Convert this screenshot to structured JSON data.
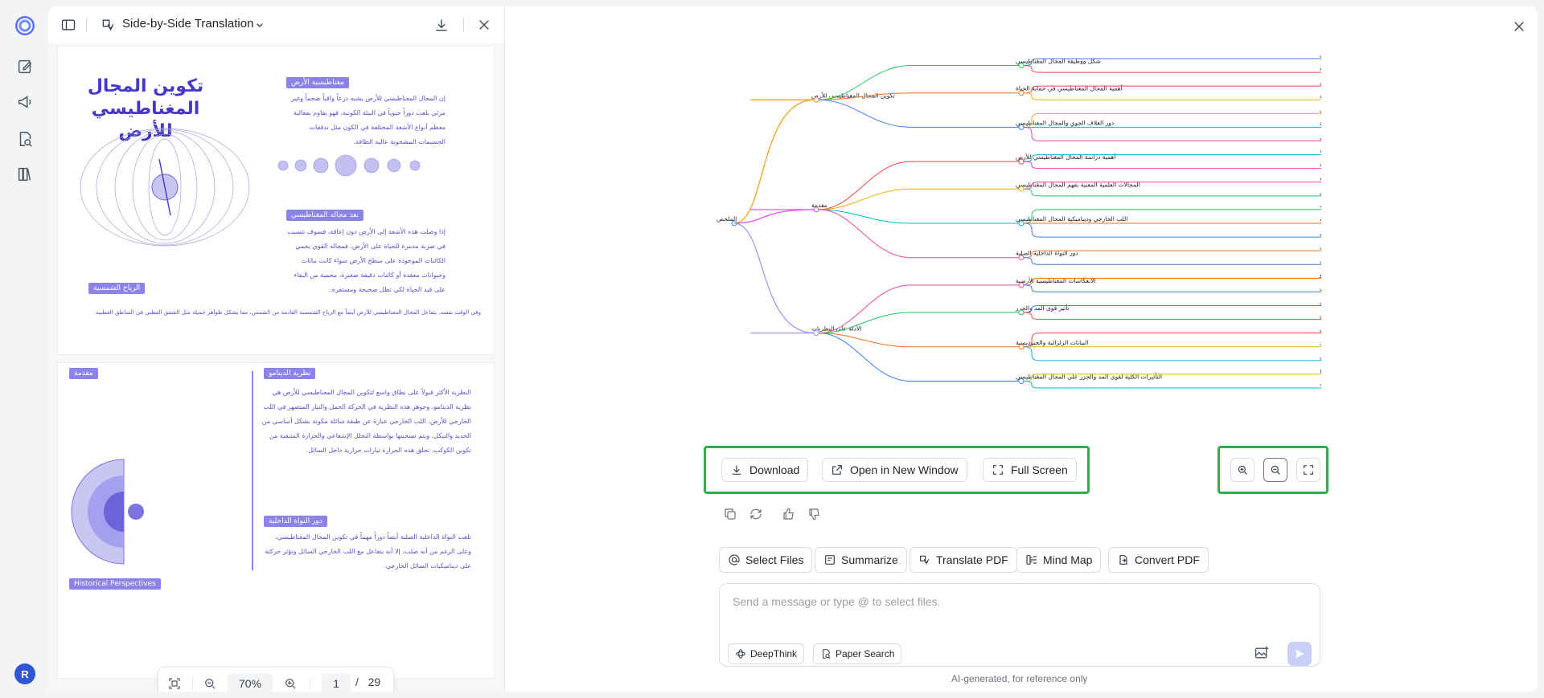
{
  "sidebar": {
    "icons": [
      "app-logo-icon",
      "edit-icon",
      "megaphone-icon",
      "doc-search-icon",
      "library-icon"
    ],
    "avatar_letter": "R"
  },
  "pdf_panel": {
    "title": "Side-by-Side Translation",
    "page1": {
      "title_line1": "تكوين المجال",
      "title_line2": "المغناطيسي للأرض",
      "label_1": "مغناطيسية الأرض",
      "label_2": "بعد مجاله المغناطيسي",
      "label_3": "الرياح الشمسية",
      "para_1": "إن المجال المغناطيسي للأرض يشبه درعاً واقياً ضخماً وغير مرئي يلعب دوراً حيوياً في البيئة الكونية، فهو يقاوم بفعالية معظم أنواع الأشعة المختلفة في الكون مثل تدفقات الجسيمات المشحونة عالية الطاقة.",
      "para_2": "إذا وصلت هذه الأشعة إلى الأرض دون إعاقة، فسوف تتسبب في ضربة مدمرة للحياة على الأرض، فمجاله القوي يحمي الكائنات الموجودة على سطح الأرض سواء كانت نباتات وحيوانات معقدة أو كائنات دقيقة صغيرة، محمية من البقاء على قيد الحياة لكي تظل صحيحة ومستقرة.",
      "para_3": "وفي الوقت نفسه، يتفاعل المجال المغناطيسي للأرض أيضاً مع الرياح الشمسية القادمة من الشمس، مما يشكل ظواهر جميلة مثل الشفق القطبي في المناطق القطبية."
    },
    "page2": {
      "label_intro": "مقدمة",
      "label_dynamo": "نظرية الدينامو",
      "label_core": "دور النواة الداخلية",
      "label_hist": "Historical Perspectives",
      "para_dynamo": "النظرية الأكثر قبولاً على نطاق واسع لتكوين المجال المغناطيسي للأرض هي نظرية الدينامو، وجوهر هذه النظرية في الحركة الحمل والتيار المتصهر في اللب الخارجي للأرض، اللب الخارجي عبارة عن طبقة سائلة مكونة بشكل أساسي من الحديد والنيكل، ويتم تسخينها بواسطة التحلل الإشعاعي والحرارة المتبقية من تكوين الكوكب، تخلق هذه الحرارة تيارات حرارية داخل السائل.",
      "para_core": "تلعب النواة الداخلية الصلبة أيضاً دوراً مهماً في تكوين المجال المغناطيسي، وعلى الرغم من أنه صلب، إلا أنه يتفاعل مع اللب الخارجي السائل وتؤثر حركته على ديناميكيات السائل الخارجي."
    },
    "zoom": {
      "value": "70%",
      "page": "1",
      "separator": "/",
      "total": "29"
    }
  },
  "mindmap": {
    "root": "الملخص",
    "branches": [
      {
        "label": "تكوين المجال المغناطيسي للأرض",
        "children": [
          {
            "label": "شكل ووظيفة المجال المغناطيسي",
            "leaves": [
              "يحمي المجال المغناطيسي الأرض من الإشعاع الكوني",
              "يقاوم بفعالية معظم أنواع الأشعة المختلفة في الكون مثل تدفقات الجسيمات المشحونة عالية الطاقة"
            ]
          },
          {
            "label": "أهمية المجال المغناطيسي في حماية الحياة",
            "leaves": [
              "يعمل المجال المغناطيسي كدرع: إذا وصلت الأشعة إلى الأرض دون إعاقة، فقد تتسبب بضربة مدمرة للحياة على الأرض",
              "يؤدي فقدان المجال إلى انقراض سريع للكائنات الحية المعقدة والدقيقة"
            ]
          },
          {
            "label": "دور الغلاف الجوي والمجال المغناطيسي",
            "leaves": [
              "الغلاف الجوي يعمل كطبقة إضافية لحماية المجال المغناطيسي للأرض",
              "إذا فقد الغلاف دوره في الحماية، ستضعف الأرض تدريجياً تحت تأثير الرياح الشمسية",
              "يوفر المجال المغناطيسي ضمانة لزيادة الحياة والحفاظ على وجود الغلاف الجوي"
            ]
          }
        ]
      },
      {
        "label": "مقدمة",
        "children": [
          {
            "label": "أهمية دراسة المجال المغناطيسي للأرض",
            "leaves": [
              "المجال المغناطيسي للأرض موضوع جاذب في كوكبنا، وكان اهتمام العلماء لفترة طويلة",
              "يلعب دوراً مهماً في حماية الحياة على الأرض من الإشعاع الكوني والجسيمات الشمسية"
            ]
          },
          {
            "label": "المجالات العلمية المعنية بفهم المجال المغناطيسي",
            "leaves": [
              "فهم تكوين المجال المغناطيسي مرتبط بعدة تخصصات علمية من الجيوفيزياء إلى علم الأحياء الفلكية",
              "النظرية الأكثر قبولاً لتكوينه هي نظرية الدينامو التي تقوم على حركة الحديد والنيكل المنصهر في اللب الخارجي للأرض"
            ]
          },
          {
            "label": "اللب الخارجي وديناميكية المجال المغناطيسي",
            "leaves": [
              "اللب الخارجي هو طبقة سائلة ساخنة تتسخن بفعل انحلال العناصر المشعة وحرارة تكوين الكوكب",
              "تؤدي التيارات الحرارية داخل السائل، مع دوران الأرض وقوة كوريوليس، إلى توليد تيارات كهربائية",
              "نتيجة لحركة الحمل الحراري والدوران في اللب الخارجي تولد عملية دينامو ذاتية الاستدامة تنتج المجال المغناطيسي للأرض"
            ]
          },
          {
            "label": "دور النواة الداخلية الصلبة",
            "leaves": [
              "النواة الداخلية الصلبة تؤدي دوراً في تكوين المجال المغناطيسي",
              "تتفاعل هذه النواة مع اللب الخارجي السائل، وتتأثر عمليات النمو والتبلور داخل اللب الداخلي على ديناميكيات اللب الخارجي، مما يؤثر في توليد المجال المغناطيسي"
            ]
          }
        ]
      },
      {
        "label": "الأدلة على النظريات",
        "children": [
          {
            "label": "الانعكاسات المغناطيسية الأرضية",
            "leaves": [
              "حدوث الانعكاسات المغناطيسية الأرضية هو أحد أقوى الأدلة لصالح نظرية الدينامو",
              "كشفت الدراسات الجيولوجية للصخور القديمة أن المجال المغناطيسي للأرض ينعكس قطبيته عدة مرات في الماضي"
            ]
          },
          {
            "label": "تأثير قوى المد والجزر",
            "leaves": [
              "أثبتت الدراسات المحتملة لتأثير قوى المد والجزر، خصوصاً تلك التي يمارسها القمر على الأرض",
              "تسبب تقلبات المد والجزر في المحيطات الأرض قد تنتج قوى احتكاك على سطح الأرض"
            ]
          },
          {
            "label": "البيانات الزلزالية والجيوديسية",
            "leaves": [
              "توفر البيانات الزلزالية معلومات عن بنية وخصائص باطن الأرض",
              "من خلال تحليل انتقال الموجات الزلزالية عبر اللب يمكن للعلماء تحديد الحالة الفيزيائية (صلبة أو سائلة) وتكوين وكثافة المواد",
              "الخرائط المستمدة من مسوحات الجاذبية والمجال المغناطيسي الصناعي في فهم ديناميكيات اللب - الوشاح وعملية توليد المجال المغناطيسي"
            ]
          },
          {
            "label": "التأثيرات الكلية لقوى المد والجزر على المجال المغناطيسي",
            "leaves": [
              "لقوى المد والجزر يمكن أن يؤثر إلى حد ما على توزيع الحرارة الداخلية للأرض وديناميكيات نظام اللب - الوشاح",
              "قد يؤدي ذلك إلى اضطرابات في توليد المجال المغناطيسي، مسببة انعكاسات"
            ]
          }
        ]
      }
    ]
  },
  "mindmap_actions": {
    "download": "Download",
    "open_new_window": "Open in New Window",
    "full_screen": "Full Screen"
  },
  "quick_actions": {
    "select_files": "Select Files",
    "summarize": "Summarize",
    "translate_pdf": "Translate PDF",
    "mind_map": "Mind Map",
    "convert_pdf": "Convert PDF"
  },
  "composer": {
    "placeholder": "Send a message or type @ to select files.",
    "deepthink": "DeepThink",
    "paper_search": "Paper Search"
  },
  "footnote": "AI-generated, for reference only",
  "colors": {
    "accent_green": "#2bb34a",
    "brand_blue": "#3056d3",
    "branch_1": "#f59e0b",
    "branch_2": "#d946ef",
    "branch_3": "#a78bfa"
  }
}
